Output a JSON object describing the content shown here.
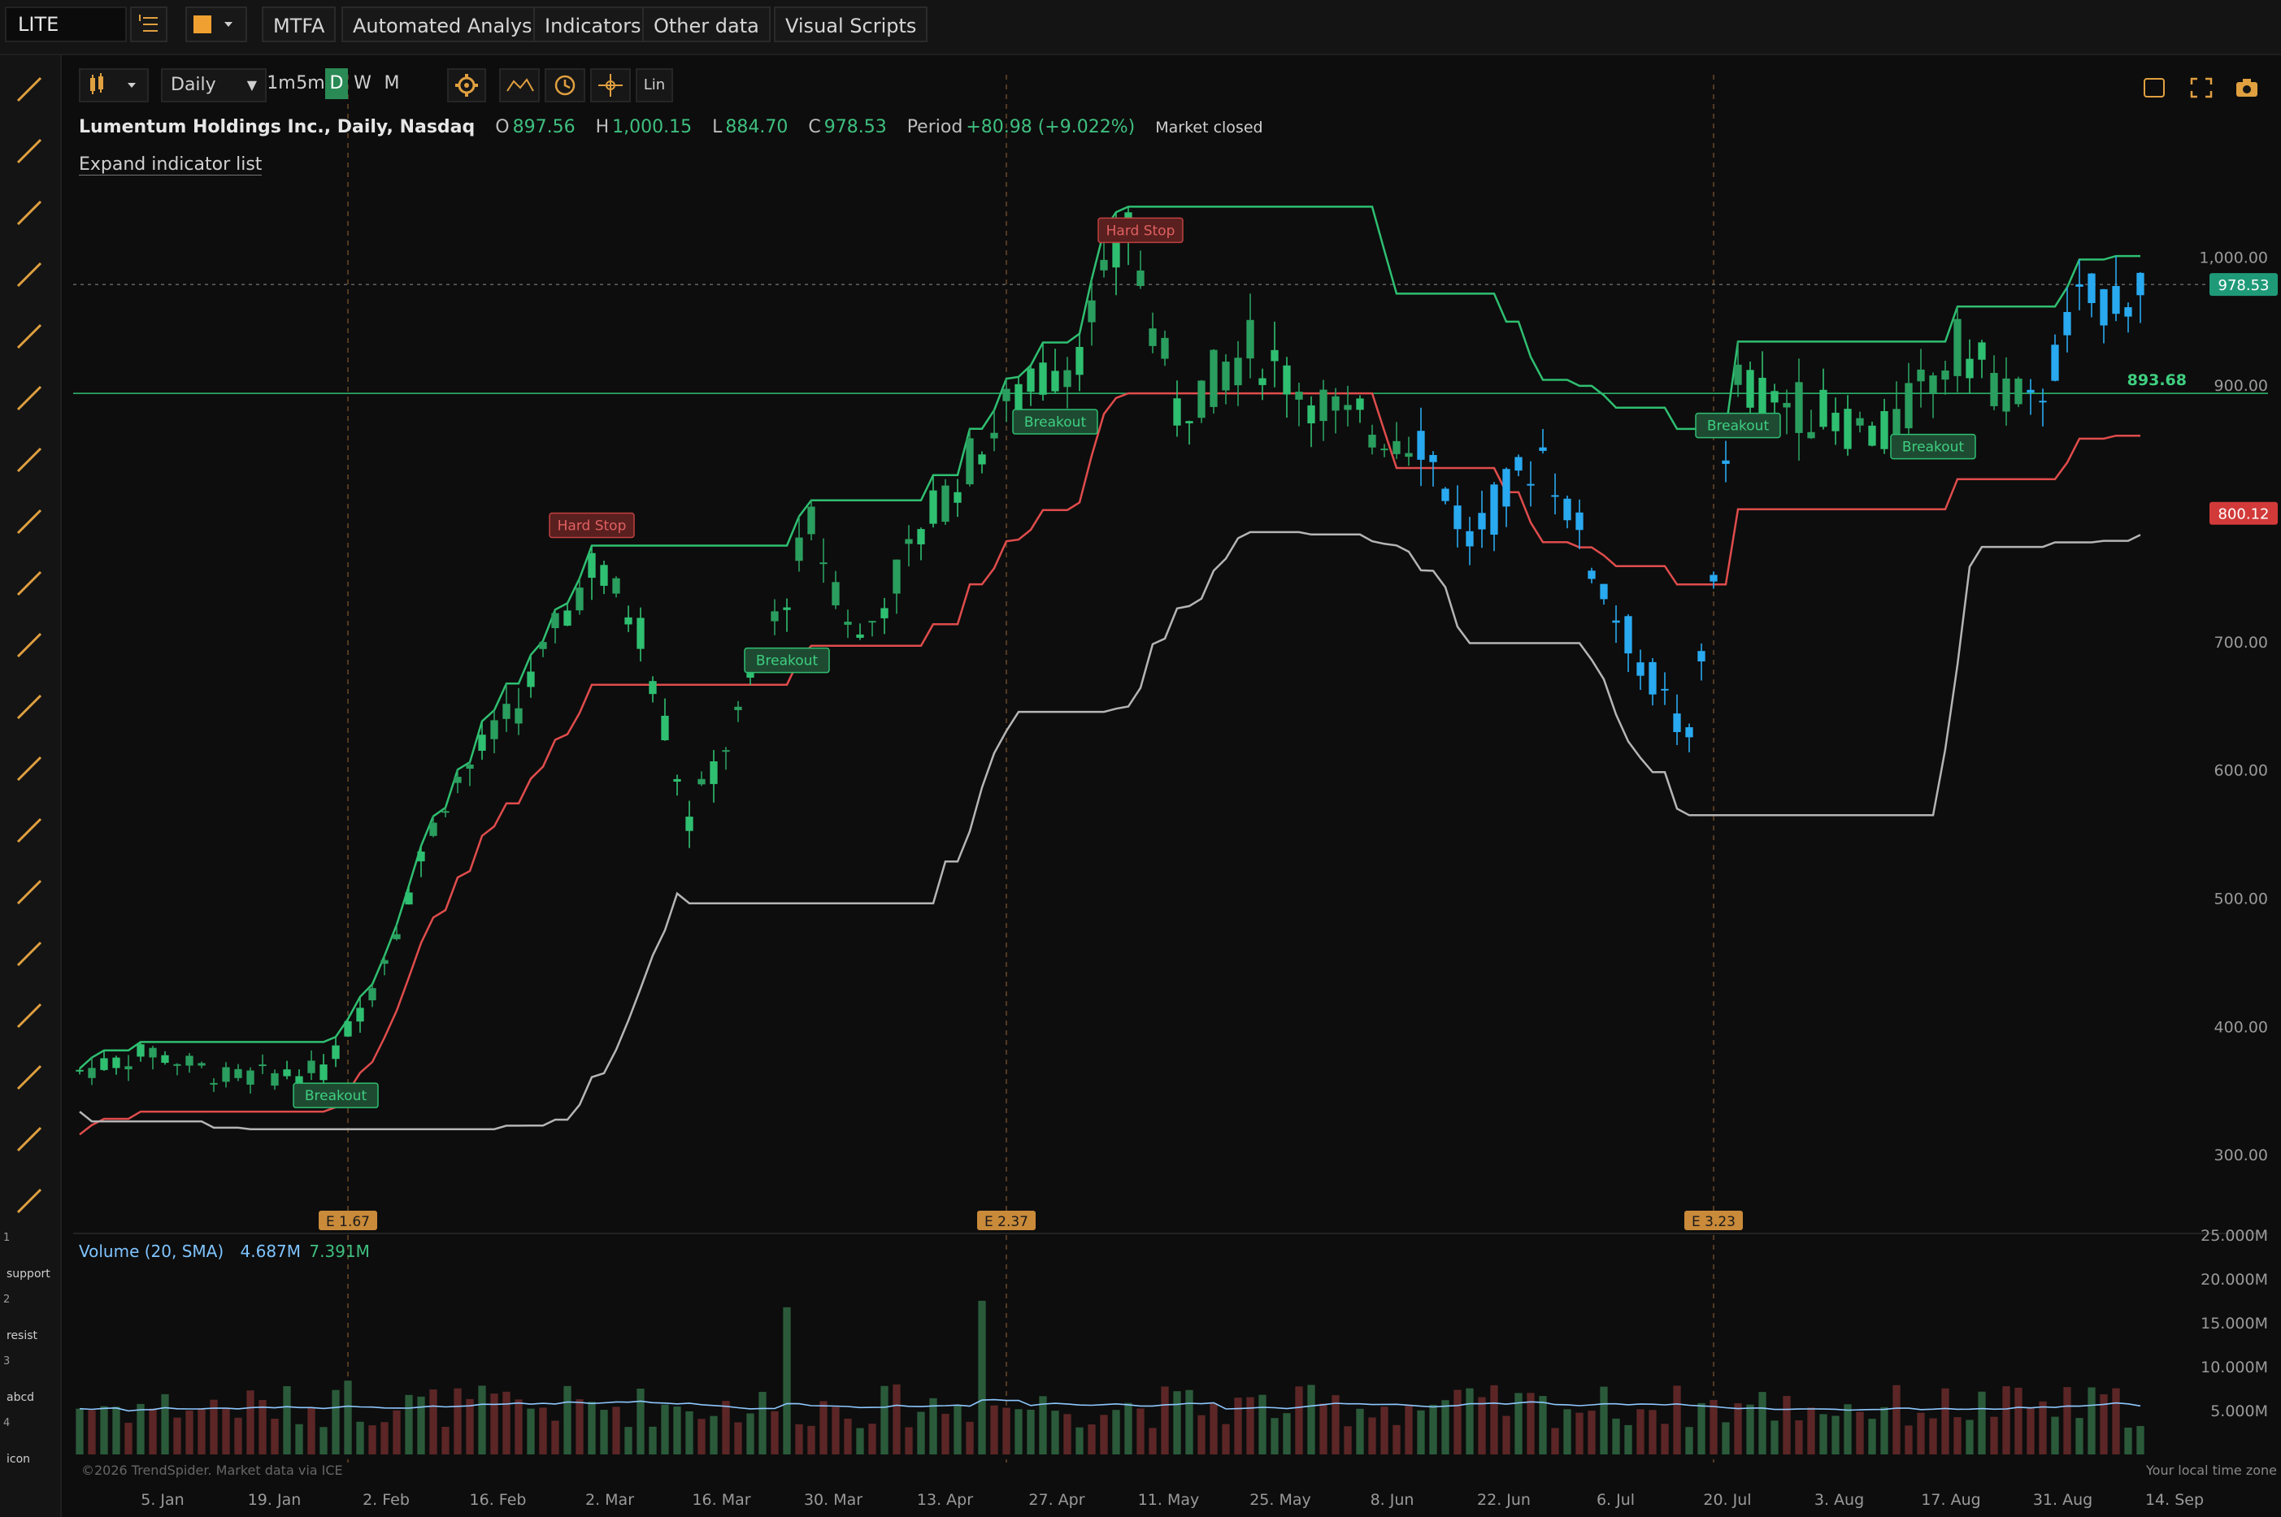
{
  "symbol": "LITE",
  "toolbar": {
    "mtfa": "MTFA",
    "automated": "Automated Analysis",
    "indicators": "Indicators",
    "other": "Other data",
    "visual": "Visual Scripts"
  },
  "controls": {
    "interval": "Daily",
    "timeframes": [
      "1m",
      "5m",
      "D",
      "W",
      "M"
    ],
    "active_timeframe": "D",
    "scale": "Lin"
  },
  "legend": {
    "title": "Lumentum Holdings Inc., Daily, Nasdaq",
    "o_label": "O",
    "o": "897.56",
    "h_label": "H",
    "h": "1,000.15",
    "l_label": "L",
    "l": "884.70",
    "c_label": "C",
    "c": "978.53",
    "period_label": "Period",
    "period": "+80.98 (+9.022%)",
    "status": "Market closed"
  },
  "expand_label": "Expand indicator list",
  "volume_legend": {
    "name": "Volume (20, SMA)",
    "v1": "4.687M",
    "v2": "7.391M"
  },
  "left_tools": [
    "trendline-icon",
    "ray-icon",
    "arrow-line-icon",
    "channel-icon",
    "rectangle-icon",
    "fill-rect-icon",
    "circle-icon",
    "text-icon",
    "arrow-down-icon",
    "vertical-line-icon",
    "crosshair-icon",
    "horizontal-line-icon",
    "fib-icon",
    "fib-fan-icon",
    "parallel-lines-icon",
    "polyline-icon",
    "curve-icon",
    "volume-profile-icon",
    "anchor-icon"
  ],
  "presets": [
    {
      "num": "1",
      "label": "support"
    },
    {
      "num": "2",
      "label": "resist"
    },
    {
      "num": "3",
      "label": "abcd"
    },
    {
      "num": "4",
      "label": "icon"
    }
  ],
  "footer": {
    "copyright": "©2026 TrendSpider. Market data via ICE",
    "timezone": "Your local time zone"
  },
  "colors": {
    "up": "#2fbf71",
    "down": "#b23a3a",
    "blue": "#29a9f0",
    "upper": "#2fbf71",
    "lower": "#e04c4c",
    "stop": "#b5b5b5"
  },
  "chart_data": {
    "type": "candlestick",
    "ylim": [
      250,
      1080
    ],
    "yticks": [
      "1,000.00",
      "900.00",
      "700.00",
      "600.00",
      "500.00",
      "400.00",
      "300.00"
    ],
    "ytick_values": [
      1000,
      900,
      700,
      600,
      500,
      400,
      300
    ],
    "xticks": [
      "5. Jan",
      "19. Jan",
      "2. Feb",
      "16. Feb",
      "2. Mar",
      "16. Mar",
      "30. Mar",
      "13. Apr",
      "27. Apr",
      "11. May",
      "25. May",
      "8. Jun",
      "22. Jun",
      "6. Jul",
      "20. Jul",
      "3. Aug",
      "17. Aug",
      "31. Aug",
      "14. Sep"
    ],
    "price_labels": {
      "last": "978.53",
      "last_value": 978.53,
      "line": "800.12",
      "line_value": 800.12,
      "hline": "893.68",
      "hline_value": 893.68
    },
    "earnings": [
      {
        "label": "E 1.67",
        "index": 22
      },
      {
        "label": "E 2.37",
        "index": 76
      },
      {
        "label": "E 3.23",
        "index": 134
      }
    ],
    "signals": [
      {
        "label": "Breakout",
        "index": 21
      },
      {
        "label": "Hard Stop",
        "index": 42
      },
      {
        "label": "Breakout",
        "index": 58
      },
      {
        "label": "Breakout",
        "index": 80
      },
      {
        "label": "Hard Stop",
        "index": 87
      },
      {
        "label": "Breakout",
        "index": 136
      },
      {
        "label": "Breakout",
        "index": 152
      }
    ],
    "volume": {
      "ylim": [
        0,
        25
      ],
      "unit": "M",
      "yticks": [
        "25.000M",
        "20.000M",
        "15.000M",
        "10.000M",
        "5.000M"
      ],
      "ytick_values": [
        25,
        20,
        15,
        10,
        5
      ]
    }
  }
}
